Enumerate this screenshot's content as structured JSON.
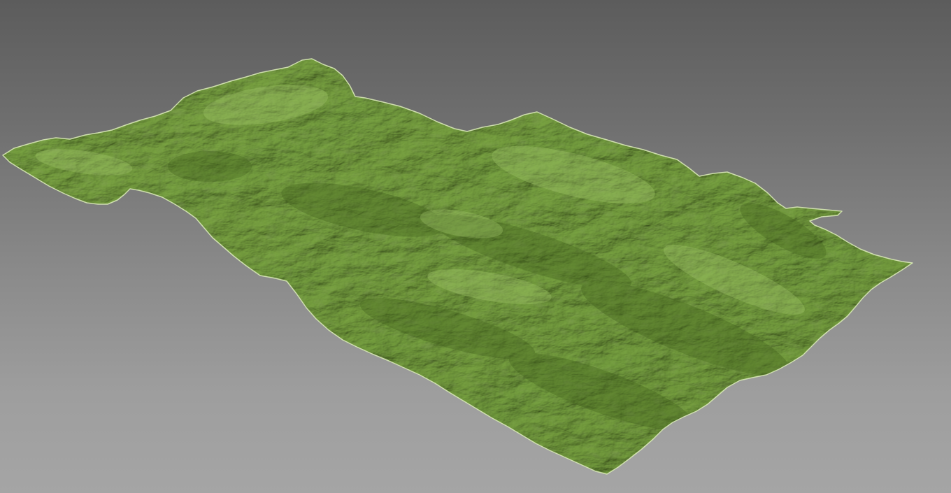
{
  "scene": {
    "subject": "terrain-mesh",
    "colors": {
      "background_top": "#5c5c5c",
      "background_bottom": "#a5a5a5",
      "terrain_base": "#6f9a3a",
      "terrain_highlight": "#9cc45c",
      "terrain_shadow": "#3f5f1c",
      "edge": "#d8e8b8"
    }
  }
}
